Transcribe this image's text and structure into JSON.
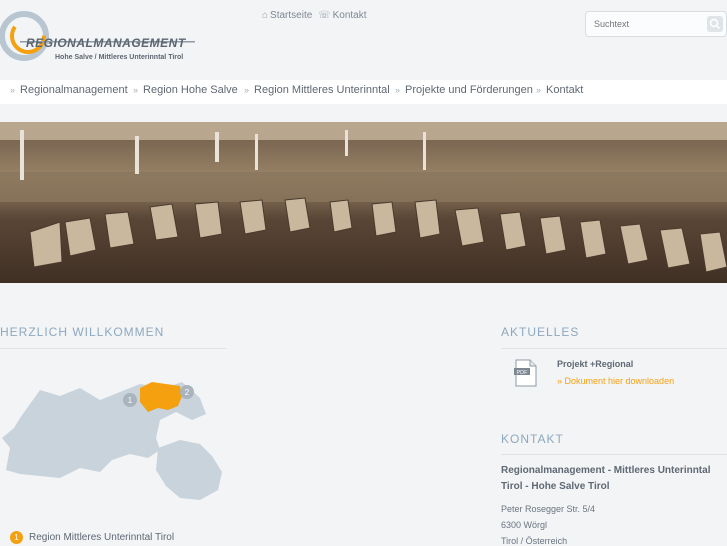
{
  "header": {
    "logo_text": "REGIONALMANAGEMENT",
    "logo_subtitle": "Hohe Salve / Mittleres Unterinntal Tirol",
    "top_links": [
      "Startseite",
      "Kontakt"
    ],
    "search_placeholder": "Suchtext"
  },
  "nav": {
    "items": [
      "Regionalmanagement",
      "Region Hohe Salve",
      "Region Mittleres Unterinntal",
      "Projekte und Förderungen",
      "Kontakt"
    ]
  },
  "main": {
    "welcome_title": "HERZLICH WILLKOMMEN",
    "map_markers": [
      "1",
      "2"
    ],
    "region_list": [
      {
        "number": "1",
        "label": "Region Mittleres Unterinntal Tirol"
      }
    ]
  },
  "sidebar": {
    "news_heading": "AKTUELLES",
    "news_item_title": "Projekt +Regional",
    "news_item_link": "» Dokument hier downloaden",
    "contact_heading": "KONTAKT",
    "contact_name": "Regionalmanagement - Mittleres Unterinntal Tirol - Hohe Salve Tirol",
    "contact_street": "Peter Rosegger Str. 5/4",
    "contact_city": "6300 Wörgl",
    "contact_country": "Tirol / Österreich"
  },
  "colors": {
    "accent": "#f5a10f",
    "heading": "#8ea8be",
    "map": "#c9d3dc"
  }
}
